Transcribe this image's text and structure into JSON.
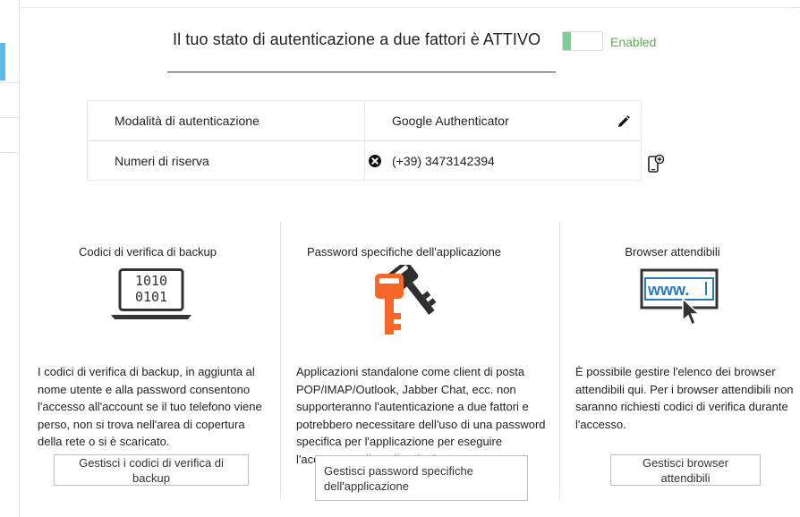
{
  "header": {
    "status_text": "Il tuo stato di autenticazione a due fattori è ATTIVO",
    "toggle_label": "Enabled",
    "toggle_on": true,
    "accent_color": "#7ad08f"
  },
  "auth_table": {
    "rows": [
      {
        "label": "Modalità di autenticazione",
        "value": "Google Authenticator",
        "action_icon": "pencil-icon"
      },
      {
        "label": "Numeri di riserva",
        "value": "(+39) 3473142394",
        "action_icon": "remove-circle-icon"
      }
    ],
    "add_icon": "add-phone-icon"
  },
  "sections": [
    {
      "title": "Codici di verifica di backup",
      "icon": "laptop-binary-icon",
      "icon_text": [
        "1010",
        "0101"
      ],
      "description": "I codici di verifica di backup, in aggiunta al nome utente e alla password consentono l'accesso all'account se il tuo telefono viene perso, non si trova nell'area di copertura della rete o si è scaricato.",
      "button": "Gestisci i codici di verifica di backup"
    },
    {
      "title": "Password specifiche dell'applicazione",
      "icon": "keys-icon",
      "description": "Applicazioni standalone come client di posta POP/IMAP/Outlook, Jabber Chat, ecc. non supporteranno l'autenticazione a due fattori e potrebbero necessitare dell'uso di una password specifica per l'applicazione per eseguire l'accesso a tali applicazioni.",
      "button": "Gestisci password specifiche dell'applicazione"
    },
    {
      "title": "Browser attendibili",
      "icon": "browser-www-icon",
      "icon_text": "www.",
      "description": "È possibile gestire l'elenco dei browser attendibili qui. Per i browser attendibili non saranno richiesti codici di verifica durante l'accesso.",
      "button": "Gestisci browser attendibili"
    }
  ]
}
